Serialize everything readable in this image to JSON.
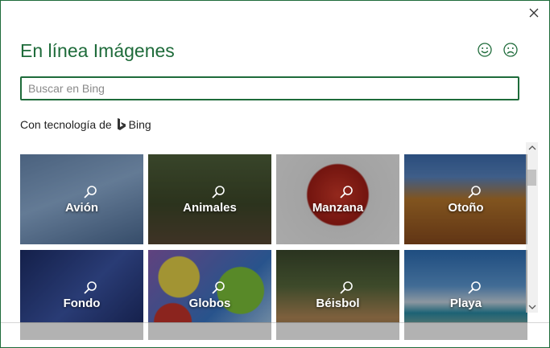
{
  "dialog": {
    "title": "En línea Imágenes",
    "close_icon": "close-icon",
    "feedback": {
      "happy_icon": "smiley-happy-icon",
      "sad_icon": "smiley-sad-icon"
    }
  },
  "search": {
    "placeholder": "Buscar en Bing",
    "value": ""
  },
  "powered_by": {
    "prefix": "Con tecnología de",
    "brand": "Bing"
  },
  "categories": [
    {
      "label": "Avión",
      "icon": "search-icon"
    },
    {
      "label": "Animales",
      "icon": "search-icon"
    },
    {
      "label": "Manzana",
      "icon": "search-icon"
    },
    {
      "label": "Otoño",
      "icon": "search-icon"
    },
    {
      "label": "Fondo",
      "icon": "search-icon"
    },
    {
      "label": "Globos",
      "icon": "search-icon"
    },
    {
      "label": "Béisbol",
      "icon": "search-icon"
    },
    {
      "label": "Playa",
      "icon": "search-icon"
    }
  ],
  "colors": {
    "accent": "#1e6b3a",
    "text": "#222222",
    "placeholder": "#8a8a8a"
  }
}
